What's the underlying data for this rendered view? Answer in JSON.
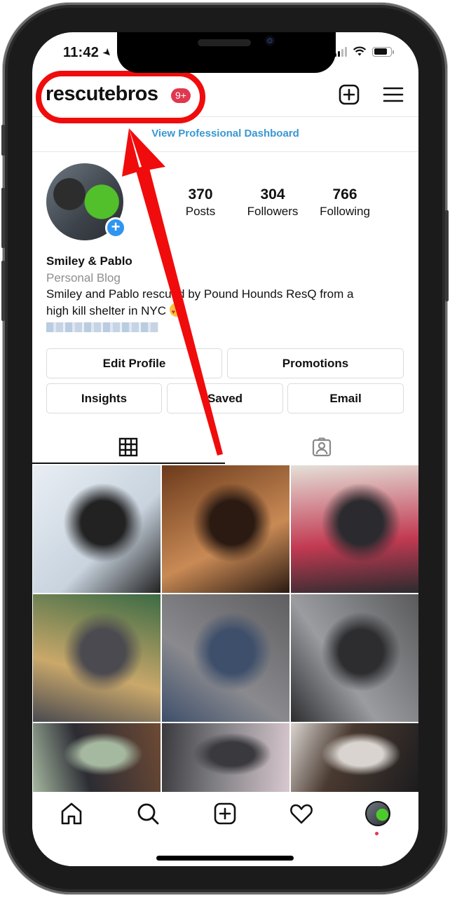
{
  "status_bar": {
    "time": "11:42",
    "location_icon": "location-arrow-icon",
    "wifi_icon": "wifi-icon",
    "battery_icon": "battery-icon"
  },
  "header": {
    "username": "rescutebros",
    "notification_badge": "9+",
    "new_post_icon": "plus-square-icon",
    "menu_icon": "hamburger-menu-icon"
  },
  "professional_dashboard_link": "View Professional Dashboard",
  "profile": {
    "stats": [
      {
        "value": "370",
        "label": "Posts"
      },
      {
        "value": "304",
        "label": "Followers"
      },
      {
        "value": "766",
        "label": "Following"
      }
    ],
    "display_name": "Smiley & Pablo",
    "category": "Personal Blog",
    "bio_line_1": "Smiley and Pablo rescued by Pound Hounds ResQ from a",
    "bio_line_2": "high kill shelter in NYC",
    "bio_emoji": "heart-eyes-emoji",
    "website_link": "(blurred link)"
  },
  "buttons": {
    "edit_profile": "Edit Profile",
    "promotions": "Promotions",
    "insights": "Insights",
    "saved": "Saved",
    "email": "Email"
  },
  "tabs": [
    {
      "name": "grid",
      "icon": "grid-icon",
      "active": true
    },
    {
      "name": "tagged",
      "icon": "tagged-person-icon",
      "active": false
    }
  ],
  "posts": [
    {
      "description": "black dog digging in snow",
      "colors": [
        "#e9eef4",
        "#c8d3de",
        "#222222"
      ]
    },
    {
      "description": "close-up of dog nose in warm light",
      "colors": [
        "#6b3a1c",
        "#c98a55",
        "#2a1a12"
      ]
    },
    {
      "description": "dog yawning on red cushion",
      "colors": [
        "#e4e0d8",
        "#c23a52",
        "#2b2b2f"
      ]
    },
    {
      "description": "man holding gray dog on couch",
      "colors": [
        "#3c6b45",
        "#caa86a",
        "#4a4a50"
      ]
    },
    {
      "description": "gray dog upside down on lap",
      "colors": [
        "#5f5f62",
        "#8a8a8e",
        "#3e4f6b"
      ]
    },
    {
      "description": "dog on bed next to robot vacuum",
      "colors": [
        "#5a5a5c",
        "#9a9ca0",
        "#2d2d30"
      ]
    },
    {
      "description": "dog with tennis ball on deck",
      "colors": [
        "#6e4a34",
        "#2c2c34",
        "#a5b8a0"
      ]
    },
    {
      "description": "puppy on gray plush bed",
      "colors": [
        "#d8c8cf",
        "#7a7a7e",
        "#3a3a3e"
      ]
    },
    {
      "description": "dog face against dark background",
      "colors": [
        "#1c1c1e",
        "#4a3a30",
        "#d9d4d0"
      ]
    }
  ],
  "bottom_nav": [
    {
      "name": "home",
      "icon": "home-icon"
    },
    {
      "name": "search",
      "icon": "search-icon"
    },
    {
      "name": "new-post",
      "icon": "plus-square-icon"
    },
    {
      "name": "activity",
      "icon": "heart-icon"
    },
    {
      "name": "profile",
      "icon": "profile-avatar"
    }
  ],
  "annotation": {
    "highlight": "username-with-notification-badge",
    "color": "#f00c0c"
  }
}
